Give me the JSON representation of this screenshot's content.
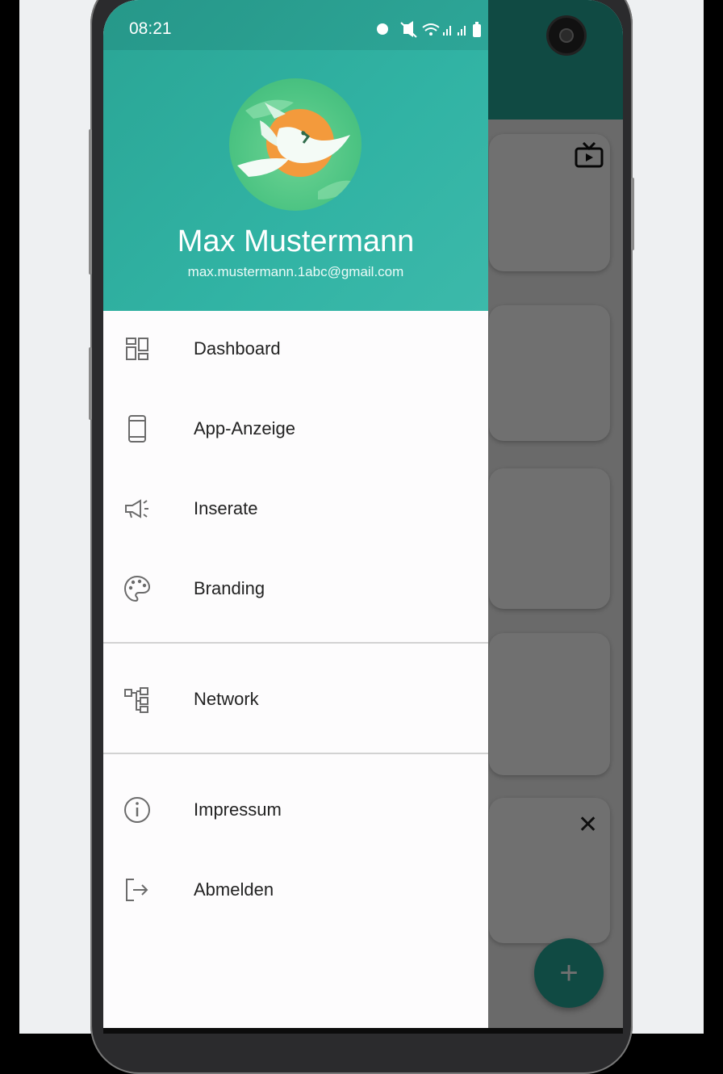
{
  "status_bar": {
    "time": "08:21",
    "icons": [
      "alarm-icon",
      "mute-icon",
      "wifi-icon",
      "signal-icon",
      "signal-icon",
      "battery-icon"
    ]
  },
  "profile": {
    "name": "Max Mustermann",
    "email": "max.mustermann.1abc@gmail.com",
    "avatar": "dove-logo"
  },
  "menu": {
    "dashboard": {
      "label": "Dashboard",
      "icon": "dashboard-icon"
    },
    "app_display": {
      "label": "App-Anzeige",
      "icon": "phone-icon"
    },
    "ads": {
      "label": "Inserate",
      "icon": "megaphone-icon"
    },
    "branding": {
      "label": "Branding",
      "icon": "palette-icon"
    },
    "network": {
      "label": "Network",
      "icon": "network-icon"
    },
    "imprint": {
      "label": "Impressum",
      "icon": "info-icon"
    },
    "logout": {
      "label": "Abmelden",
      "icon": "logout-icon"
    }
  },
  "background_app": {
    "fab_label": "+",
    "close_label": "✕"
  },
  "colors": {
    "primary": "#26a99a",
    "drawer_background": "#fdfcfd",
    "text": "#222222",
    "icon": "#6b6b6b"
  }
}
